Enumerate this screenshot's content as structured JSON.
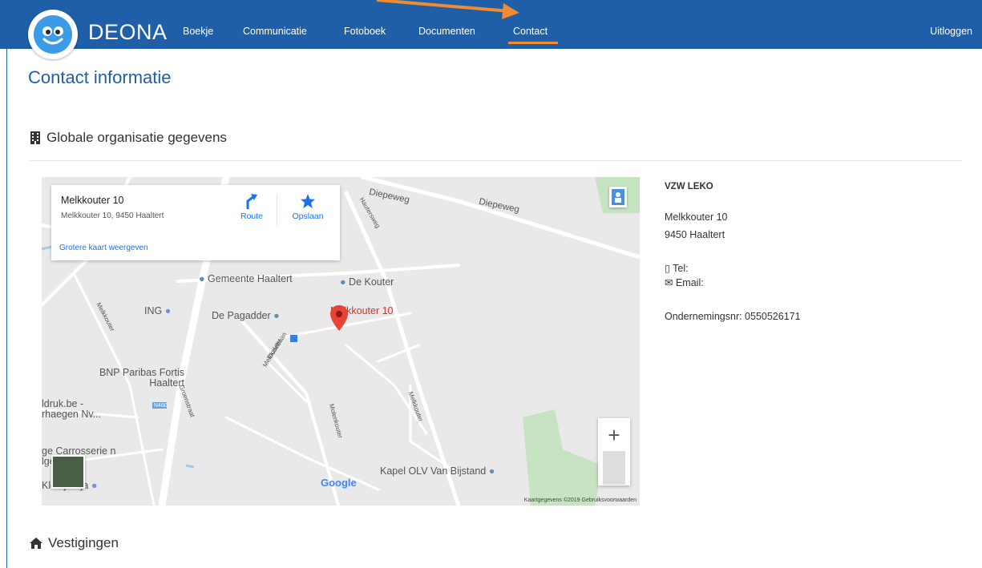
{
  "header": {
    "brand": "DEONA",
    "nav": [
      "Boekje",
      "Communicatie",
      "Fotoboek",
      "Documenten",
      "Contact"
    ],
    "active_nav": "Contact",
    "logout": "Uitloggen",
    "accent_color": "#1f5fa8",
    "highlight_color": "#f28b30"
  },
  "page": {
    "title": "Contact informatie",
    "section_org": "Globale organisatie gegevens",
    "section_branches": "Vestigingen"
  },
  "map": {
    "card": {
      "title": "Melkkouter 10",
      "address": "Melkkouter 10, 9450 Haaltert",
      "route": "Route",
      "save": "Opslaan",
      "larger_map": "Grotere kaart weergeven"
    },
    "streets": [
      "Diepeweg",
      "Diepeweg",
      "Hautersweg",
      "Melkkouter",
      "Melkkouter",
      "Groenstraat",
      "Molenkouter",
      "Melkkouter",
      "Oudebaan"
    ],
    "pois": [
      "Gemeente Haaltert",
      "De Kouter",
      "ING",
      "De Pagadder",
      "Melkkouter 10",
      "BNP Paribas Fortis Haaltert",
      "ldruk.be - rhaegen Nv...",
      "ge Carrosserie n lgen...",
      "Kapel OLV Van Bijstand",
      "Kledij Anja"
    ],
    "road_badge": "N460",
    "google": "Google",
    "footer": "Kaartgegevens ©2019   Gebruiksvoorwaarden",
    "zoom_in": "+",
    "zoom_out": "−"
  },
  "organization": {
    "name": "VZW LEKO",
    "street": "Melkkouter 10",
    "city": "9450 Haaltert",
    "phone_label": "Tel:",
    "email_label": "Email:",
    "company_number": "Ondernemingsnr: 0550526171"
  }
}
